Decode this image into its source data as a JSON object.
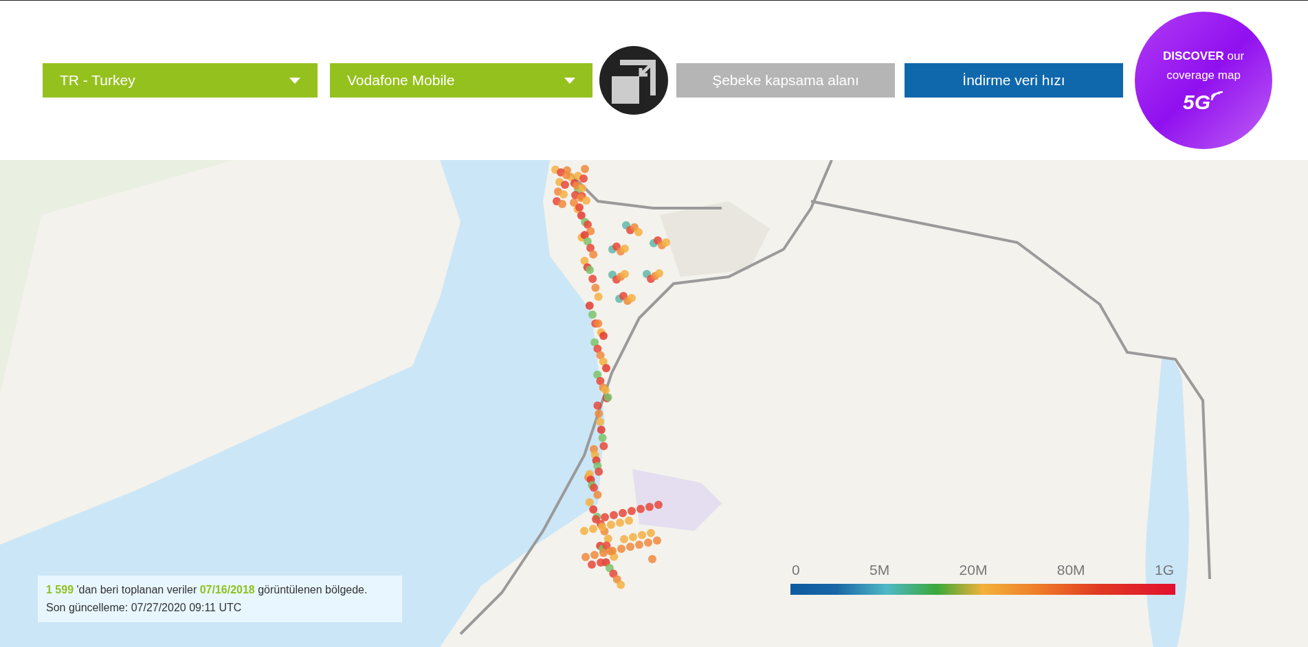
{
  "filters": [
    {
      "value": "TR - Turkey"
    },
    {
      "value": "Vodafone Mobile"
    }
  ],
  "tabs": [
    {
      "label": "Şebeke kapsama alanı",
      "selected": false
    },
    {
      "label": "İndirme veri hızı",
      "selected": true
    }
  ],
  "promo": {
    "text": "**DISCOVER** our coverage map",
    "badge": "5G"
  },
  "info": {
    "lines": [
      "**1 599** 'dan beri toplanan veriler **07/16/2018** görüntülenen bölgede.",
      "Son güncelleme: 07/27/2020 09:11 UTC"
    ]
  },
  "legend": {
    "labels": [
      "0",
      "5M",
      "20M",
      "80M",
      "1G"
    ]
  }
}
